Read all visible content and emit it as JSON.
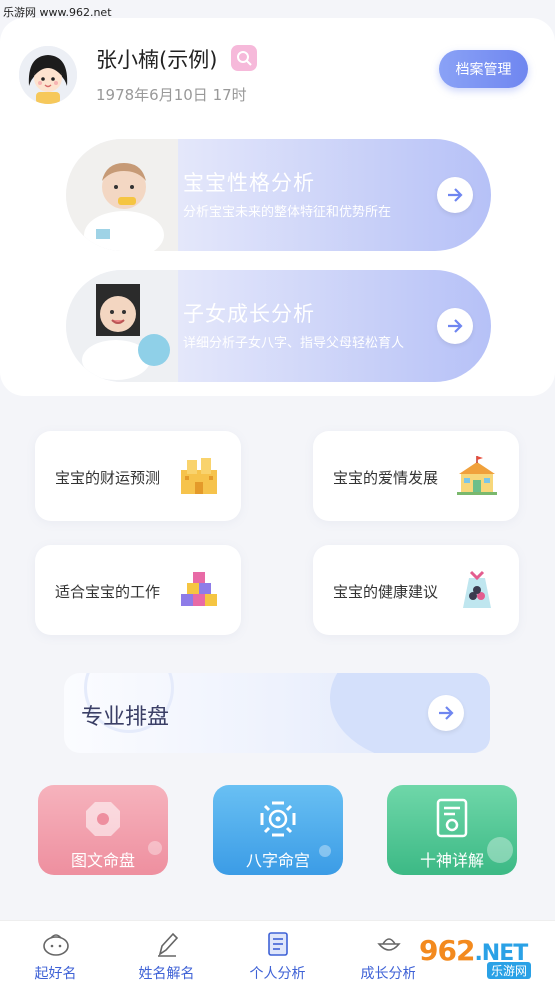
{
  "watermark": {
    "top_text": "乐游网 www.962.net",
    "logo_text": "962",
    "logo_suffix": ".NET",
    "site_text": "乐游网"
  },
  "profile": {
    "name": "张小楠(示例)",
    "birth": "1978年6月10日 17时",
    "archive_button": "档案管理"
  },
  "features": [
    {
      "title": "宝宝性格分析",
      "subtitle": "分析宝宝未来的整体特征和优势所在"
    },
    {
      "title": "子女成长分析",
      "subtitle": "详细分析子女八字、指导父母轻松育人"
    }
  ],
  "grid": [
    {
      "label": "宝宝的财运预测",
      "icon": "castle-icon"
    },
    {
      "label": "宝宝的爱情发展",
      "icon": "house-icon"
    },
    {
      "label": "适合宝宝的工作",
      "icon": "cubes-icon"
    },
    {
      "label": "宝宝的健康建议",
      "icon": "medicine-bag-icon"
    }
  ],
  "pro": {
    "title": "专业排盘"
  },
  "tiles": [
    {
      "label": "图文命盘",
      "color": "#f2a3b0"
    },
    {
      "label": "八字命宫",
      "color": "#57b4ef"
    },
    {
      "label": "十神详解",
      "color": "#52c79b"
    }
  ],
  "tabs": [
    {
      "label": "起好名",
      "icon": "baby-face-icon"
    },
    {
      "label": "姓名解名",
      "icon": "pen-icon"
    },
    {
      "label": "个人分析",
      "icon": "book-icon"
    },
    {
      "label": "成长分析",
      "icon": "cradle-icon"
    }
  ],
  "colors": {
    "accent": "#6f86f0",
    "tab_text": "#3f62d6"
  }
}
